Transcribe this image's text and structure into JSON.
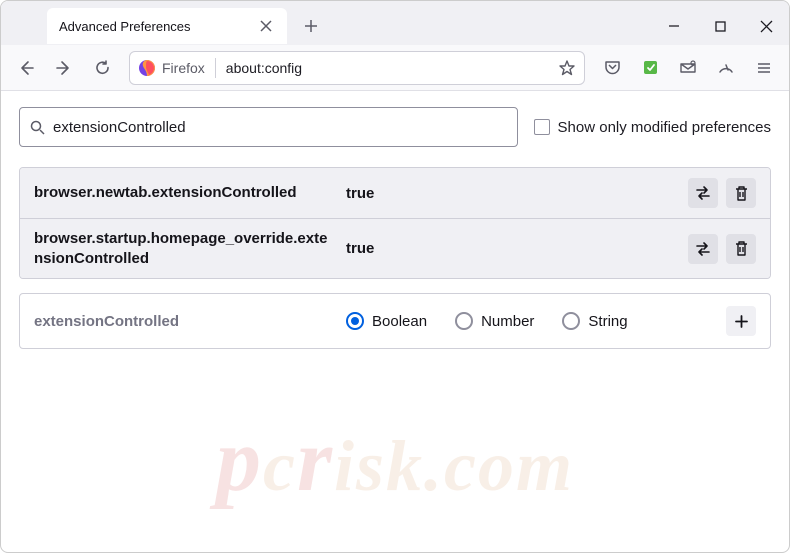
{
  "window": {
    "tab_title": "Advanced Preferences"
  },
  "urlbar": {
    "identity_label": "Firefox",
    "url": "about:config"
  },
  "search": {
    "value": "extensionControlled",
    "checkbox_label": "Show only modified preferences"
  },
  "prefs": [
    {
      "name": "browser.newtab.extensionControlled",
      "value": "true"
    },
    {
      "name": "browser.startup.homepage_override.extensionControlled",
      "value": "true"
    }
  ],
  "add_row": {
    "name": "extensionControlled",
    "options": [
      "Boolean",
      "Number",
      "String"
    ],
    "selected": "Boolean"
  },
  "watermark": "pcrisk.com"
}
